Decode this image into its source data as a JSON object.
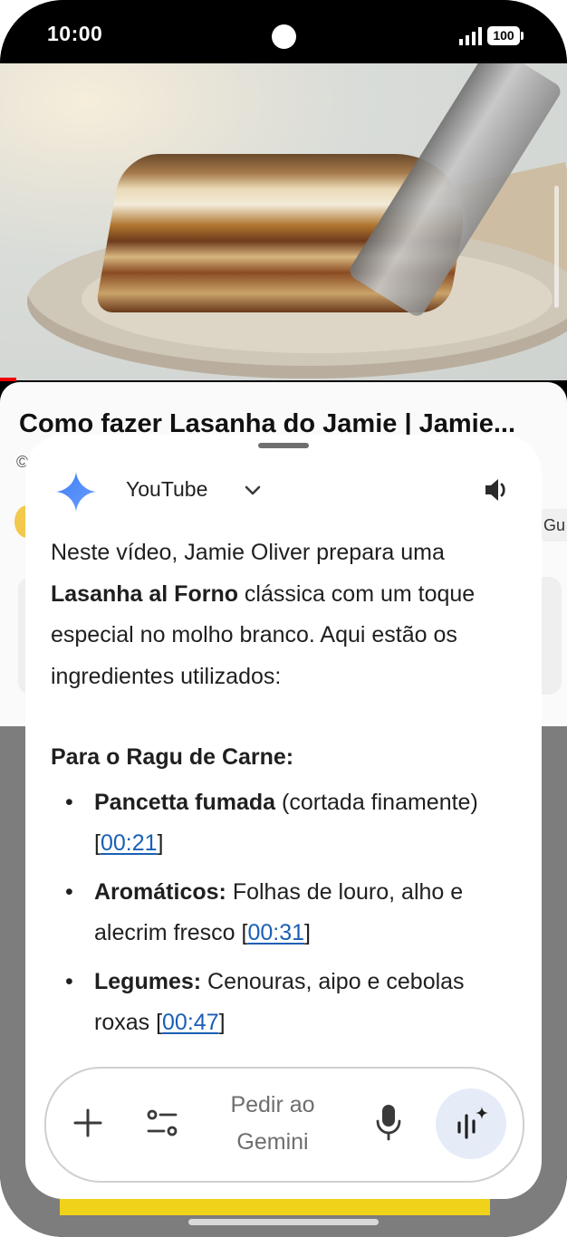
{
  "status_bar": {
    "time": "10:00",
    "battery": "100"
  },
  "video_page": {
    "title": "Como fazer Lasanha do Jamie | Jamie...",
    "meta": "©",
    "partial_button": "Gu"
  },
  "gemini_sheet": {
    "source_label": "YouTube",
    "intro_before": "Neste vídeo, Jamie Oliver prepara uma ",
    "intro_bold": "Lasanha al Forno",
    "intro_after": " clássica com um toque especial no molho branco. Aqui estão os ingredientes utilizados:",
    "section_title": "Para o Ragu de Carne:",
    "items": [
      {
        "bold": "Pancetta fumada",
        "text": " (cortada finamente) [",
        "link": "00:21",
        "end": "]"
      },
      {
        "bold": "Aromáticos:",
        "text": " Folhas de louro, alho e alecrim fresco [",
        "link": "00:31",
        "end": "]"
      },
      {
        "bold": "Legumes:",
        "text": " Cenouras, aipo e cebolas roxas [",
        "link": "00:47",
        "end": "]"
      }
    ],
    "input_placeholder_line1": "Pedir ao",
    "input_placeholder_line2": "Gemini"
  },
  "icons": [
    "gemini-star-icon",
    "chevron-down-icon",
    "speaker-icon",
    "plus-icon",
    "tune-icon",
    "mic-icon",
    "live-icon"
  ],
  "colors": {
    "link": "#1a5fb4",
    "gemini_blue": "#4f8bf9",
    "live_bg": "#e6ecf7"
  }
}
